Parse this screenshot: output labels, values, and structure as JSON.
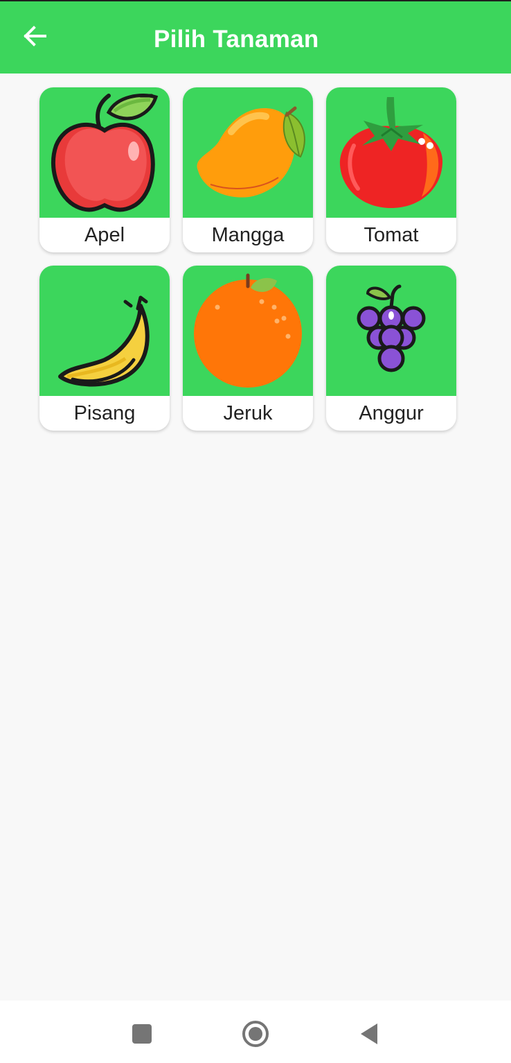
{
  "appbar": {
    "title": "Pilih Tanaman",
    "background": "#3cd65c"
  },
  "plants": [
    {
      "label": "Apel",
      "icon": "apple-icon"
    },
    {
      "label": "Mangga",
      "icon": "mango-icon"
    },
    {
      "label": "Tomat",
      "icon": "tomato-icon"
    },
    {
      "label": "Pisang",
      "icon": "banana-icon"
    },
    {
      "label": "Jeruk",
      "icon": "orange-icon"
    },
    {
      "label": "Anggur",
      "icon": "grapes-icon"
    }
  ],
  "navbar": {
    "icons": [
      "recents-icon",
      "home-icon",
      "back-triangle-icon"
    ]
  }
}
